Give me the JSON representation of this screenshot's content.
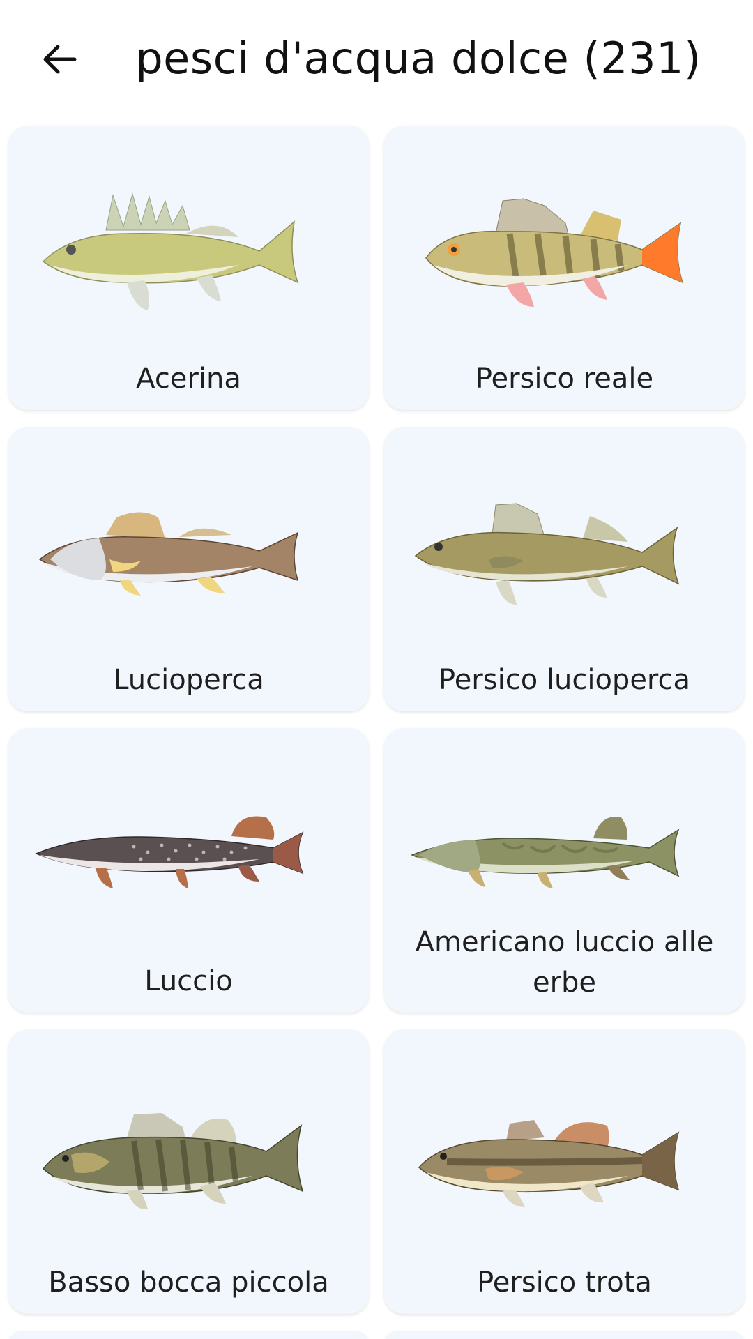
{
  "header": {
    "back_icon": "arrow-left-icon",
    "title": "pesci d'acqua dolce (231)"
  },
  "cards": [
    {
      "name": "Acerina"
    },
    {
      "name": "Persico reale"
    },
    {
      "name": "Lucioperca"
    },
    {
      "name": "Persico lucioperca"
    },
    {
      "name": "Luccio"
    },
    {
      "name": "Americano luccio alle erbe"
    },
    {
      "name": "Basso bocca piccola"
    },
    {
      "name": "Persico trota"
    }
  ],
  "colors": {
    "card_background": "#f2f7fd",
    "page_background": "#ffffff",
    "text": "#1f1f1f"
  }
}
